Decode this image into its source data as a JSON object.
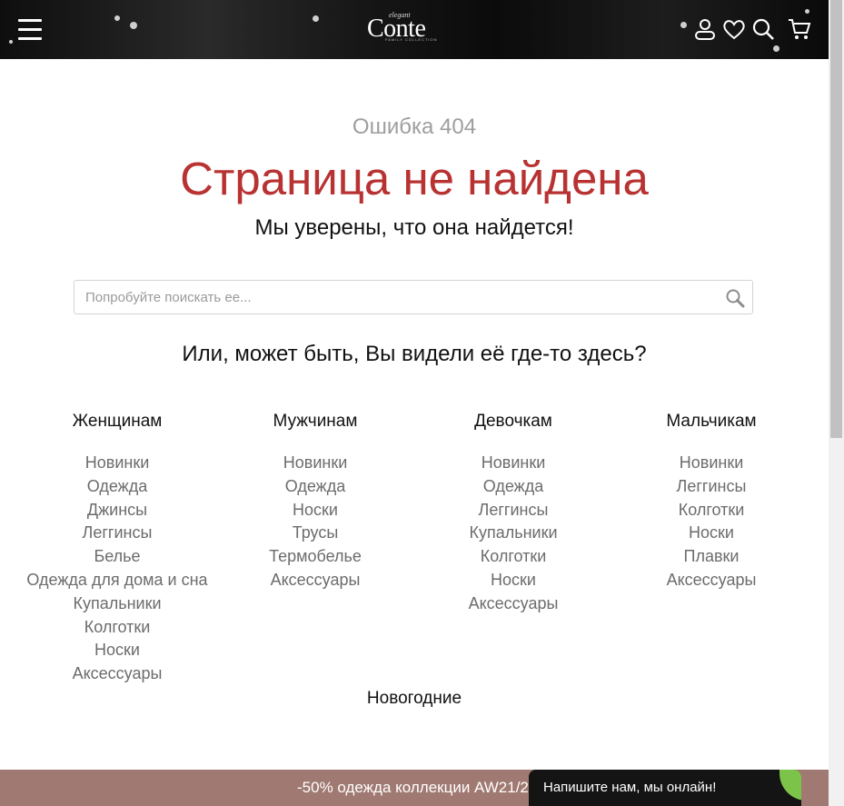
{
  "header": {
    "logo": {
      "main": "Conte",
      "top": "elegant",
      "sub": "FAMILY COLLECTION"
    },
    "icons": [
      "menu-icon",
      "user-icon",
      "heart-icon",
      "search-icon",
      "cart-icon"
    ]
  },
  "error": {
    "code": "Ошибка 404",
    "title": "Страница не найдена",
    "subtitle": "Мы уверены, что она найдется!"
  },
  "search": {
    "placeholder": "Попробуйте поискать ее...",
    "value": ""
  },
  "suggest": "Или, может быть, Вы видели её где-то здесь?",
  "categories": [
    {
      "title": "Женщинам",
      "links": [
        "Новинки",
        "Одежда",
        "Джинсы",
        "Леггинсы",
        "Белье",
        "Одежда для дома и сна",
        "Купальники",
        "Колготки",
        "Носки",
        "Аксессуары"
      ]
    },
    {
      "title": "Мужчинам",
      "links": [
        "Новинки",
        "Одежда",
        "Носки",
        "Трусы",
        "Термобелье",
        "Аксессуары"
      ]
    },
    {
      "title": "Девочкам",
      "links": [
        "Новинки",
        "Одежда",
        "Леггинсы",
        "Купальники",
        "Колготки",
        "Носки",
        "Аксессуары"
      ]
    },
    {
      "title": "Мальчикам",
      "links": [
        "Новинки",
        "Леггинсы",
        "Колготки",
        "Носки",
        "Плавки",
        "Аксессуары"
      ]
    }
  ],
  "newyear": "Новогодние",
  "promo": {
    "text": "-50% одежда коллекции AW21/22"
  },
  "chat": {
    "text": "Напишите нам, мы онлайн!"
  },
  "colors": {
    "accent": "#b83232",
    "promo_bg": "#a07a72",
    "chat_bg": "#141414",
    "chat_leaf": "#7cc34a"
  }
}
